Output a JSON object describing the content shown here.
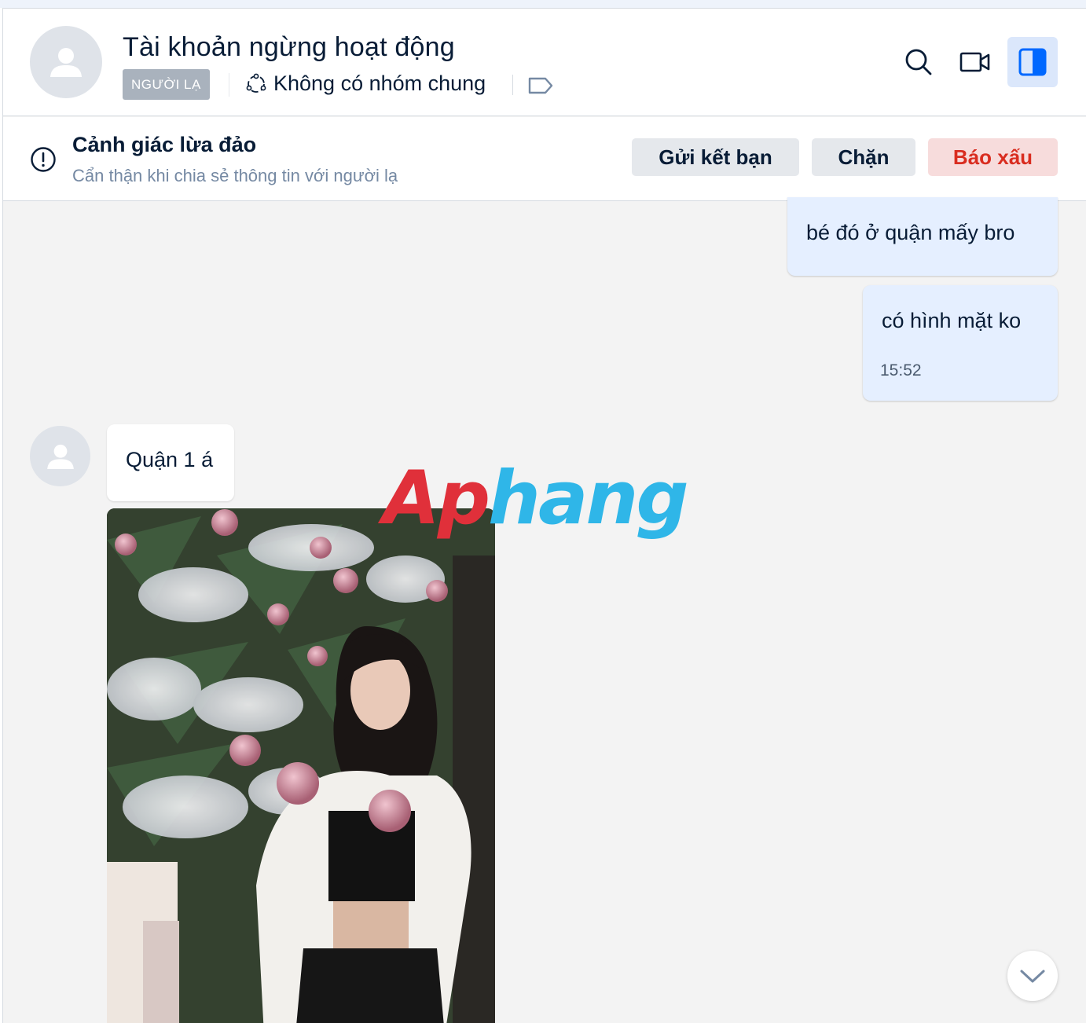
{
  "header": {
    "title": "Tài khoản ngừng hoạt động",
    "badge": "NGƯỜI LẠ",
    "group_text": "Không có nhóm chung",
    "icons": [
      "avatar-placeholder",
      "group-icon",
      "tag-icon",
      "search-icon",
      "video-call-icon",
      "side-panel-icon"
    ]
  },
  "warning": {
    "title": "Cảnh giác lừa đảo",
    "subtitle": "Cẩn thận khi chia sẻ thông tin với người lạ",
    "add_friend": "Gửi kết bạn",
    "block": "Chặn",
    "report": "Báo xấu",
    "report_color": "#d92d20"
  },
  "messages": [
    {
      "side": "me",
      "text": "bé đó ở quận mấy bro"
    },
    {
      "side": "me",
      "text": "có hình mặt ko",
      "time": "15:52"
    },
    {
      "side": "them",
      "text": "Quận 1 á"
    },
    {
      "side": "them",
      "type": "photo"
    }
  ],
  "watermark": {
    "part1": "Ap",
    "part2": "hang"
  },
  "colors": {
    "accent": "#0068ff",
    "bubble_me": "#e5efff",
    "bg": "#f3f3f3"
  }
}
